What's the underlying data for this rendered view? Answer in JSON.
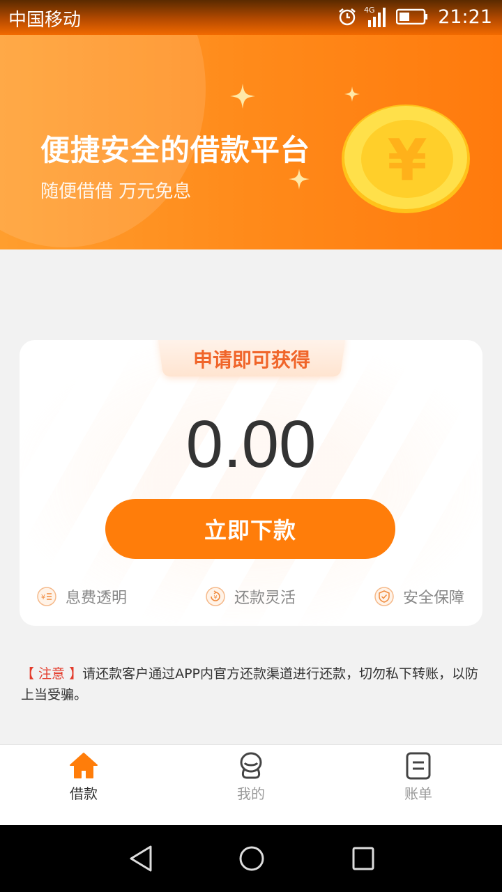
{
  "status_bar": {
    "carrier": "中国移动",
    "network": "4G",
    "time": "21:21"
  },
  "banner": {
    "title": "便捷安全的借款平台",
    "subtitle": "随便借借 万元免息",
    "coin_symbol": "¥"
  },
  "card": {
    "tag": "申请即可获得",
    "amount": "0.00",
    "cta": "立即下款",
    "features": [
      {
        "label": "息费透明",
        "icon": "fee-icon"
      },
      {
        "label": "还款灵活",
        "icon": "repay-icon"
      },
      {
        "label": "安全保障",
        "icon": "shield-icon"
      }
    ]
  },
  "notice": {
    "label": "【 注意 】",
    "text": "请还款客户通过APP内官方还款渠道进行还款，切勿私下转账，以防上当受骗。"
  },
  "tabs": [
    {
      "label": "借款",
      "icon": "home-icon",
      "active": true
    },
    {
      "label": "我的",
      "icon": "profile-icon",
      "active": false
    },
    {
      "label": "账单",
      "icon": "bill-icon",
      "active": false
    }
  ],
  "colors": {
    "accent": "#ff7d0a",
    "notice_red": "#e33b2b",
    "tab_active": "#333333",
    "tab_inactive": "#999999"
  }
}
